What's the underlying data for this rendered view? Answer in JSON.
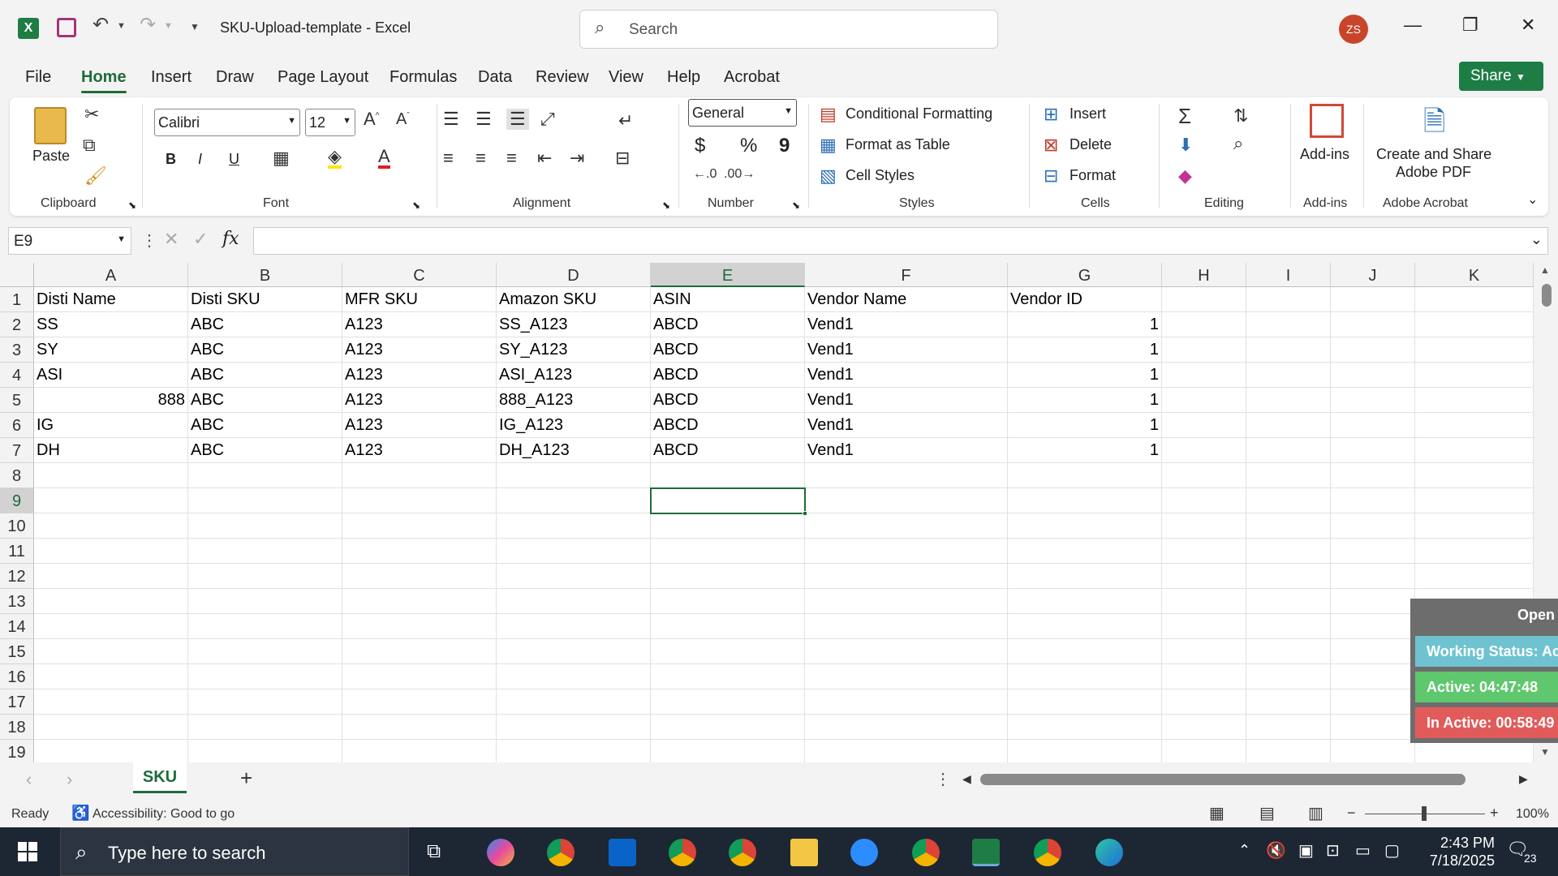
{
  "window": {
    "title": "SKU-Upload-template  -  Excel",
    "search_placeholder": "Search",
    "avatar_initials": "ZS"
  },
  "menu": {
    "tabs": [
      "File",
      "Home",
      "Insert",
      "Draw",
      "Page Layout",
      "Formulas",
      "Data",
      "Review",
      "View",
      "Help",
      "Acrobat"
    ],
    "active": "Home",
    "share_label": "Share"
  },
  "ribbon": {
    "clipboard": {
      "paste": "Paste",
      "label": "Clipboard"
    },
    "font": {
      "name": "Calibri",
      "size": "12",
      "label": "Font",
      "bold": "B",
      "italic": "I",
      "underline": "U"
    },
    "alignment": {
      "label": "Alignment"
    },
    "number": {
      "format": "General",
      "label": "Number",
      "currency": "$",
      "percent": "%",
      "comma": "9"
    },
    "styles": {
      "conditional": "Conditional Formatting",
      "table": "Format as Table",
      "cell_styles": "Cell Styles",
      "label": "Styles"
    },
    "cells": {
      "insert": "Insert",
      "delete": "Delete",
      "format": "Format",
      "label": "Cells"
    },
    "editing": {
      "label": "Editing"
    },
    "addins": {
      "button": "Add-ins",
      "label": "Add-ins"
    },
    "acrobat": {
      "button_line1": "Create and Share",
      "button_line2": "Adobe PDF",
      "label": "Adobe Acrobat"
    }
  },
  "formula_bar": {
    "name_box": "E9",
    "fx": "fx",
    "value": ""
  },
  "columns": [
    "A",
    "B",
    "C",
    "D",
    "E",
    "F",
    "G",
    "H",
    "I",
    "J",
    "K"
  ],
  "rows": [
    "1",
    "2",
    "3",
    "4",
    "5",
    "6",
    "7",
    "8",
    "9",
    "10",
    "11",
    "12",
    "13",
    "14",
    "15",
    "16",
    "17",
    "18",
    "19"
  ],
  "selected_cell": {
    "column": "E",
    "row": "9"
  },
  "sheet": {
    "headers": [
      "Disti Name",
      "Disti SKU",
      "MFR SKU",
      "Amazon SKU",
      "ASIN",
      "Vendor Name",
      "Vendor ID"
    ],
    "data": [
      [
        "SS",
        "ABC",
        "A123",
        "SS_A123",
        "ABCD",
        "Vend1",
        "1"
      ],
      [
        "SY",
        "ABC",
        "A123",
        "SY_A123",
        "ABCD",
        "Vend1",
        "1"
      ],
      [
        "ASI",
        "ABC",
        "A123",
        "ASI_A123",
        "ABCD",
        "Vend1",
        "1"
      ],
      [
        "888",
        "ABC",
        "A123",
        "888_A123",
        "ABCD",
        "Vend1",
        "1"
      ],
      [
        "IG",
        "ABC",
        "A123",
        "IG_A123",
        "ABCD",
        "Vend1",
        "1"
      ],
      [
        "DH",
        "ABC",
        "A123",
        "DH_A123",
        "ABCD",
        "Vend1",
        "1"
      ]
    ]
  },
  "sheet_tabs": [
    "SKU"
  ],
  "status": {
    "ready": "Ready",
    "accessibility": "Accessibility: Good to go",
    "zoom": "100%"
  },
  "overlay": {
    "open": "Open A",
    "working": "Working Status: Act",
    "active": "Active: 04:47:48",
    "inactive": "In Active: 00:58:49"
  },
  "taskbar": {
    "search": "Type here to search",
    "time": "2:43 PM",
    "date": "7/18/2025",
    "notifications": "23"
  },
  "colors": {
    "excel_green": "#1e6b3b",
    "share_green": "#1e7d45",
    "overlay_teal": "#6fc3d0",
    "overlay_green": "#5fc76d",
    "overlay_red": "#e25b5b"
  }
}
